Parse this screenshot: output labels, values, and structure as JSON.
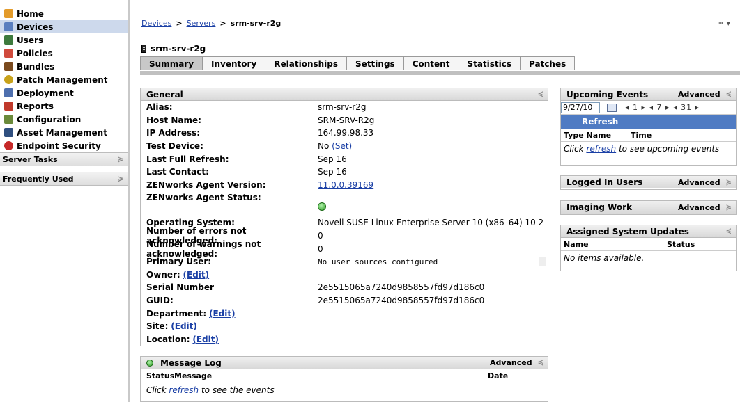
{
  "sidebar": {
    "items": [
      {
        "label": "Home",
        "icon": "home-icon",
        "color": "#e39b2a"
      },
      {
        "label": "Devices",
        "icon": "devices-icon",
        "color": "#5b7fbf",
        "active": true
      },
      {
        "label": "Users",
        "icon": "users-icon",
        "color": "#3d7a3d"
      },
      {
        "label": "Policies",
        "icon": "policies-icon",
        "color": "#d04a3c"
      },
      {
        "label": "Bundles",
        "icon": "bundles-icon",
        "color": "#7a4a1e"
      },
      {
        "label": "Patch Management",
        "icon": "shield-icon",
        "color": "#c8a21a"
      },
      {
        "label": "Deployment",
        "icon": "deployment-icon",
        "color": "#4e6fae"
      },
      {
        "label": "Reports",
        "icon": "reports-icon",
        "color": "#c0392b"
      },
      {
        "label": "Configuration",
        "icon": "wrench-icon",
        "color": "#6a8a3a"
      },
      {
        "label": "Asset Management",
        "icon": "asset-icon",
        "color": "#2f4f7f"
      },
      {
        "label": "Endpoint Security",
        "icon": "security-icon",
        "color": "#c62828"
      }
    ],
    "sections": [
      "Server Tasks",
      "Frequently Used"
    ]
  },
  "breadcrumb": {
    "devices": "Devices",
    "servers": "Servers",
    "current": "srm-srv-r2g",
    "sep": ">"
  },
  "top_right": "⚭ ▾",
  "title": "srm-srv-r2g",
  "tabs": [
    "Summary",
    "Inventory",
    "Relationships",
    "Settings",
    "Content",
    "Statistics",
    "Patches"
  ],
  "general": {
    "title": "General",
    "alias_label": "Alias:",
    "alias": "srm-srv-r2g",
    "host_label": "Host Name:",
    "host": "SRM-SRV-R2g",
    "ip_label": "IP Address:",
    "ip": "164.99.98.33",
    "test_label": "Test Device:",
    "test": "No",
    "test_link": "(Set)",
    "refresh_label": "Last Full Refresh:",
    "refresh": "Sep 16",
    "contact_label": "Last Contact:",
    "contact": "Sep 16",
    "agentver_label": "ZENworks Agent Version:",
    "agentver": "11.0.0.39169",
    "agentstatus_label": "ZENworks Agent Status:",
    "os_label": "Operating System:",
    "os": "Novell SUSE Linux Enterprise Server 10 (x86_64) 10 2",
    "errors_label": "Number of errors not acknowledged:",
    "errors": "0",
    "warnings_label": "Number of warnings not acknowledged:",
    "warnings": "0",
    "primary_label": "Primary User:",
    "primary": "No user sources configured",
    "owner_label": "Owner:",
    "edit": "(Edit)",
    "serial_label": "Serial Number",
    "serial": "2e5515065a7240d9858557fd97d186c0",
    "guid_label": "GUID:",
    "guid": "2e5515065a7240d9858557fd97d186c0",
    "dept_label": "Department:",
    "site_label": "Site:",
    "location_label": "Location:"
  },
  "msglog": {
    "title": "Message Log",
    "advanced": "Advanced",
    "col_status": "Status",
    "col_message": "Message",
    "col_date": "Date",
    "empty_prefix": "Click ",
    "empty_link": "refresh",
    "empty_suffix": " to see the events"
  },
  "upcoming": {
    "title": "Upcoming Events",
    "advanced": "Advanced",
    "date": "9/27/10",
    "steppers": "◂ 1 ▸  ◂ 7 ▸  ◂ 31 ▸",
    "refresh": "Refresh",
    "col_type": "Type Name",
    "col_time": "Time",
    "empty_prefix": "Click ",
    "empty_link": "refresh",
    "empty_suffix": " to see upcoming events"
  },
  "logged": {
    "title": "Logged In Users",
    "advanced": "Advanced"
  },
  "imaging": {
    "title": "Imaging Work",
    "advanced": "Advanced"
  },
  "sysupd": {
    "title": "Assigned System Updates",
    "col_name": "Name",
    "col_status": "Status",
    "empty": "No items available."
  }
}
